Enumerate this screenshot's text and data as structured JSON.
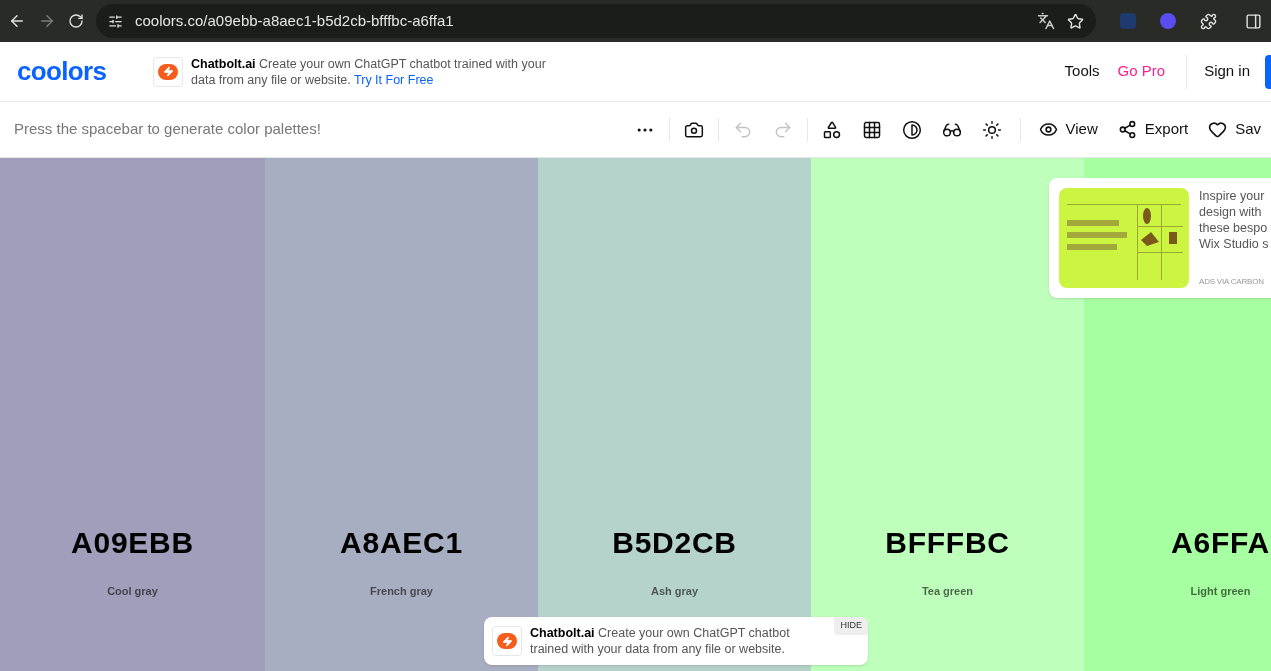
{
  "browser": {
    "url": "coolors.co/a09ebb-a8aec1-b5d2cb-bfffbc-a6ffa1",
    "forward_disabled": true
  },
  "header": {
    "logo": "coolors",
    "ad": {
      "brand": "Chatbolt.ai",
      "text": "Create your own ChatGPT chatbot trained with your data from any file or website.",
      "link": "Try It For Free"
    },
    "nav": [
      {
        "label": "Tools",
        "kind": "plain"
      },
      {
        "label": "Go Pro",
        "kind": "pro"
      },
      {
        "label": "Sign in",
        "kind": "plain"
      }
    ]
  },
  "toolbar": {
    "hint": "Press the spacebar to generate color palettes!",
    "undo_disabled": true,
    "redo_disabled": true,
    "actions": [
      "View",
      "Export",
      "Sav"
    ]
  },
  "palette": [
    {
      "hex": "A09EBB",
      "name": "Cool gray",
      "color": "#a09ebb"
    },
    {
      "hex": "A8AEC1",
      "name": "French gray",
      "color": "#a8aec1"
    },
    {
      "hex": "B5D2CB",
      "name": "Ash gray",
      "color": "#b5d2cb"
    },
    {
      "hex": "BFFFBC",
      "name": "Tea green",
      "color": "#bfffbc"
    },
    {
      "hex": "A6FFA",
      "name": "Light green",
      "color": "#a6ffa1"
    }
  ],
  "side_ad": {
    "lines": [
      "Inspire your",
      "design with",
      "these bespo",
      "Wix Studio s"
    ],
    "source": "ADS VIA CARBON"
  },
  "popup": {
    "brand": "Chatbolt.ai",
    "text": "Create your own ChatGPT chatbot trained with your data from any file or website.",
    "hide": "HIDE"
  }
}
